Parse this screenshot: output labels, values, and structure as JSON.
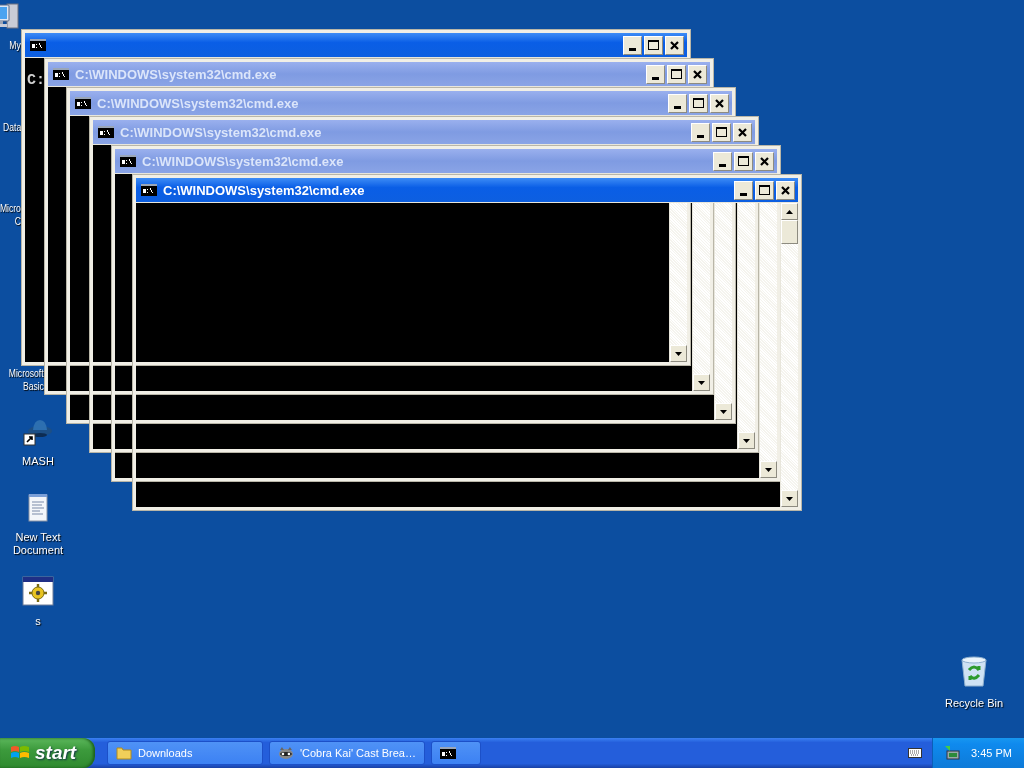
{
  "desktop_icons": [
    {
      "kind": "computer",
      "lines": [
        "My"
      ]
    },
    {
      "kind": "hidden",
      "lines": [
        "Data"
      ]
    },
    {
      "kind": "hidden",
      "lines": [
        "Micro",
        "C"
      ]
    },
    {
      "kind": "hidden",
      "lines": [
        "Microsoft",
        "Basic"
      ]
    },
    {
      "kind": "mash",
      "lines": [
        "MASH"
      ]
    },
    {
      "kind": "text-document",
      "lines": [
        "New Text",
        "Document"
      ]
    },
    {
      "kind": "program",
      "lines": [
        "s"
      ]
    },
    {
      "kind": "recycle-bin",
      "lines": [
        "Recycle Bin"
      ]
    }
  ],
  "windows": [
    {
      "active": true,
      "console_text": "C:"
    },
    {
      "active": false,
      "title": "C:\\WINDOWS\\system32\\cmd.exe"
    },
    {
      "active": false,
      "title": "C:\\WINDOWS\\system32\\cmd.exe"
    },
    {
      "active": false,
      "title": "C:\\WINDOWS\\system32\\cmd.exe"
    },
    {
      "active": false,
      "title": "C:\\WINDOWS\\system32\\cmd.exe"
    },
    {
      "active": true,
      "title": "C:\\WINDOWS\\system32\\cmd.exe"
    }
  ],
  "taskbar": {
    "start_label": "start",
    "tasks": [
      {
        "kind": "folder",
        "label": "Downloads",
        "selected": false
      },
      {
        "kind": "media",
        "label": "'Cobra Kai' Cast Brea…",
        "selected": false
      },
      {
        "kind": "console",
        "selected": false
      }
    ],
    "clock": "3:45 PM"
  }
}
